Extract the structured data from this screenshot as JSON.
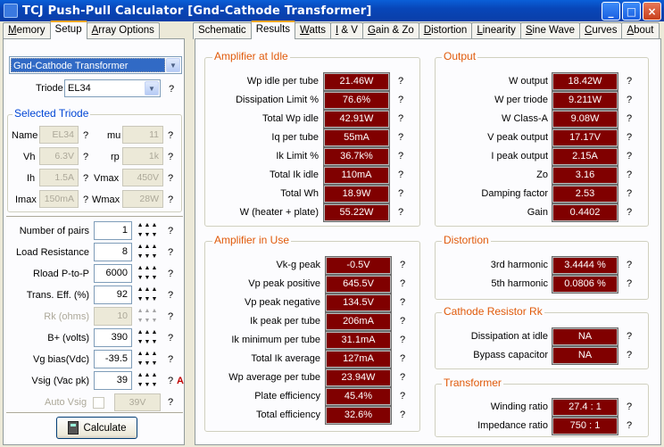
{
  "window": {
    "title": "TCJ Push-Pull Calculator [Gnd-Cathode Transformer]",
    "min": "_",
    "max": "□",
    "close": "×"
  },
  "left_tabs": [
    {
      "label": "Memory",
      "u": "M"
    },
    {
      "label": "Setup",
      "u": ""
    },
    {
      "label": "Array Options",
      "u": "A"
    }
  ],
  "right_tabs": [
    {
      "label": "Schematic",
      "u": ""
    },
    {
      "label": "Results",
      "u": ""
    },
    {
      "label": "Watts",
      "u": "W"
    },
    {
      "label": "I & V",
      "u": "I"
    },
    {
      "label": "Gain & Zo",
      "u": "G"
    },
    {
      "label": "Distortion",
      "u": "D"
    },
    {
      "label": "Linearity",
      "u": "L"
    },
    {
      "label": "Sine Wave",
      "u": "S"
    },
    {
      "label": "Curves",
      "u": "C"
    },
    {
      "label": "About",
      "u": "A"
    }
  ],
  "setup": {
    "mode": "Gnd-Cathode Transformer",
    "triode_label": "Triode",
    "triode": "EL34",
    "selected_title": "Selected Triode",
    "name_l": "Name",
    "name_v": "EL34",
    "mu_l": "mu",
    "mu_v": "11",
    "vh_l": "Vh",
    "vh_v": "6.3V",
    "rp_l": "rp",
    "rp_v": "1k",
    "ih_l": "Ih",
    "ih_v": "1.5A",
    "vmax_l": "Vmax",
    "vmax_v": "450V",
    "imax_l": "Imax",
    "imax_v": "150mA",
    "wmax_l": "Wmax",
    "wmax_v": "28W",
    "params": [
      {
        "label": "Number of pairs",
        "value": "1",
        "enabled": true
      },
      {
        "label": "Load Resistance",
        "value": "8",
        "enabled": true
      },
      {
        "label": "Rload P-to-P",
        "value": "6000",
        "enabled": true
      },
      {
        "label": "Trans. Eff. (%)",
        "value": "92",
        "enabled": true
      },
      {
        "label": "Rk (ohms)",
        "value": "10",
        "enabled": false
      },
      {
        "label": "B+ (volts)",
        "value": "390",
        "enabled": true
      },
      {
        "label": "Vg bias(Vdc)",
        "value": "-39.5",
        "enabled": true
      },
      {
        "label": "Vsig (Vac pk)",
        "value": "39",
        "enabled": true
      }
    ],
    "a_marker": "A",
    "auto_vsig_label": "Auto Vsig",
    "auto_vsig_value": "39V",
    "calculate": "Calculate"
  },
  "q": "?",
  "amp_idle": {
    "title": "Amplifier at Idle",
    "rows": [
      {
        "label": "Wp idle per tube",
        "value": "21.46W"
      },
      {
        "label": "Dissipation Limit %",
        "value": "76.6%"
      },
      {
        "label": "Total Wp idle",
        "value": "42.91W"
      },
      {
        "label": "Iq per tube",
        "value": "55mA"
      },
      {
        "label": "Ik Limit %",
        "value": "36.7k%"
      },
      {
        "label": "Total Ik idle",
        "value": "110mA"
      },
      {
        "label": "Total Wh",
        "value": "18.9W"
      },
      {
        "label": "W (heater + plate)",
        "value": "55.22W"
      }
    ]
  },
  "amp_use": {
    "title": "Amplifier in Use",
    "rows": [
      {
        "label": "Vk-g peak",
        "value": "-0.5V"
      },
      {
        "label": "Vp peak positive",
        "value": "645.5V"
      },
      {
        "label": "Vp peak negative",
        "value": "134.5V"
      },
      {
        "label": "Ik peak per tube",
        "value": "206mA"
      },
      {
        "label": "Ik minimum per tube",
        "value": "31.1mA"
      },
      {
        "label": "Total Ik average",
        "value": "127mA"
      },
      {
        "label": "Wp average per tube",
        "value": "23.94W"
      },
      {
        "label": "Plate efficiency",
        "value": "45.4%"
      },
      {
        "label": "Total efficiency",
        "value": "32.6%"
      }
    ]
  },
  "output": {
    "title": "Output",
    "rows": [
      {
        "label": "W output",
        "value": "18.42W"
      },
      {
        "label": "W per triode",
        "value": "9.211W"
      },
      {
        "label": "W Class-A",
        "value": "9.08W"
      },
      {
        "label": "V peak output",
        "value": "17.17V"
      },
      {
        "label": "I peak output",
        "value": "2.15A"
      },
      {
        "label": "Zo",
        "value": "3.16"
      },
      {
        "label": "Damping factor",
        "value": "2.53"
      },
      {
        "label": "Gain",
        "value": "0.4402"
      }
    ]
  },
  "distortion": {
    "title": "Distortion",
    "rows": [
      {
        "label": "3rd harmonic",
        "value": "3.4444 %"
      },
      {
        "label": "5th harmonic",
        "value": "0.0806 %"
      }
    ]
  },
  "cathode": {
    "title": "Cathode Resistor Rk",
    "rows": [
      {
        "label": "Dissipation at idle",
        "value": "NA"
      },
      {
        "label": "Bypass capacitor",
        "value": "NA"
      }
    ]
  },
  "transformer": {
    "title": "Transformer",
    "rows": [
      {
        "label": "Winding ratio",
        "value": "27.4 : 1"
      },
      {
        "label": "Impedance ratio",
        "value": "750 : 1"
      }
    ]
  }
}
